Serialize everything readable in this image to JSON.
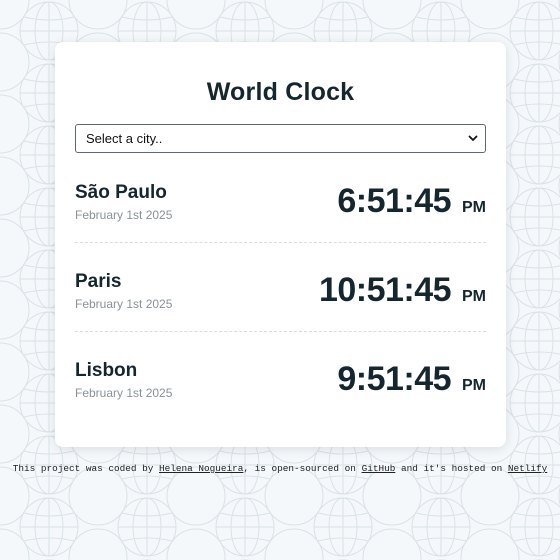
{
  "title": "World Clock",
  "select": {
    "selected_label": "Select a city.."
  },
  "cities": [
    {
      "name": "São Paulo",
      "date": "February 1st 2025",
      "time": "6:51:45",
      "ampm": "PM"
    },
    {
      "name": "Paris",
      "date": "February 1st 2025",
      "time": "10:51:45",
      "ampm": "PM"
    },
    {
      "name": "Lisbon",
      "date": "February 1st 2025",
      "time": "9:51:45",
      "ampm": "PM"
    }
  ],
  "footer": {
    "text1": "This project was coded by ",
    "author": "Helena Nogueira",
    "text2": ", is open-sourced on ",
    "repo": "GitHub",
    "text3": " and it's hosted on ",
    "host": "Netlify"
  },
  "colors": {
    "background": "#f4f8fa",
    "card": "#ffffff",
    "text": "#14262e",
    "muted": "#8a9297"
  },
  "icons": {
    "select_chevron": "chevron-down-icon",
    "background_pattern": "globe-icon"
  }
}
